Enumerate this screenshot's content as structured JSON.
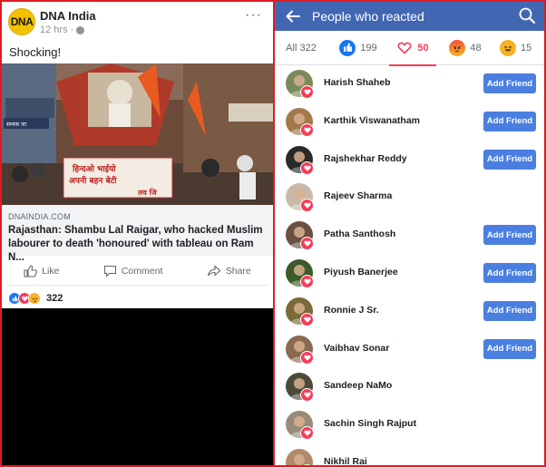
{
  "post": {
    "page_name": "DNA India",
    "avatar_text": "DNA",
    "time": "12 hrs",
    "time_separator": "·",
    "text": "Shocking!",
    "link": {
      "domain": "DNAINDIA.COM",
      "title": "Rajasthan: Shambu Lal Raigar, who hacked Muslim labourer to death 'honoured' with tableau on Ram N..."
    },
    "actions": {
      "like": "Like",
      "comment": "Comment",
      "share": "Share"
    },
    "reaction_count": "322",
    "image_sign_text": [
      "हिन्दओ भाईयो",
      "अपनी बहन बेटी",
      "लव जि"
    ],
    "image_shop_text": "सम्यक जा"
  },
  "reactions_screen": {
    "title": "People who reacted",
    "tabs": {
      "all": "All 322",
      "like": "199",
      "love": "50",
      "angry": "48",
      "haha": "15"
    },
    "add_friend_label": "Add Friend",
    "people": [
      {
        "name": "Harish Shaheb",
        "add_friend": true,
        "avatar_color": "#7a8a5a"
      },
      {
        "name": "Karthik Viswanatham",
        "add_friend": true,
        "avatar_color": "#a07a4a"
      },
      {
        "name": "Rajshekhar Reddy",
        "add_friend": true,
        "avatar_color": "#2a2a2a"
      },
      {
        "name": "Rajeev Sharma",
        "add_friend": false,
        "avatar_color": "#c9b9a9"
      },
      {
        "name": "Patha Santhosh",
        "add_friend": true,
        "avatar_color": "#6a5040"
      },
      {
        "name": "Piyush Banerjee",
        "add_friend": true,
        "avatar_color": "#3d5a2a"
      },
      {
        "name": "Ronnie J Sr.",
        "add_friend": true,
        "avatar_color": "#7a6a3a"
      },
      {
        "name": "Vaibhav Sonar",
        "add_friend": true,
        "avatar_color": "#8a6a50"
      },
      {
        "name": "Sandeep NaMo",
        "add_friend": false,
        "avatar_color": "#4a4a3a"
      },
      {
        "name": "Sachin Singh Rajput",
        "add_friend": false,
        "avatar_color": "#9a8a7a"
      },
      {
        "name": "Nikhil Rai",
        "add_friend": false,
        "avatar_color": "#b08a6a"
      }
    ]
  },
  "colors": {
    "facebook_blue": "#4267b2",
    "button_blue": "#4a7fe0",
    "love_red": "#f33e58",
    "like_blue": "#1877f2",
    "angry_yellow": "#f7b125",
    "highlight_border": "#e01b24"
  },
  "icons": {
    "back": "arrow-left-icon",
    "search": "search-icon",
    "more": "more-horizontal-icon",
    "globe": "globe-icon",
    "like": "thumbs-up-icon",
    "comment": "comment-icon",
    "share": "share-arrow-icon",
    "love": "heart-icon",
    "angry": "angry-face-icon",
    "haha": "laughing-face-icon"
  }
}
